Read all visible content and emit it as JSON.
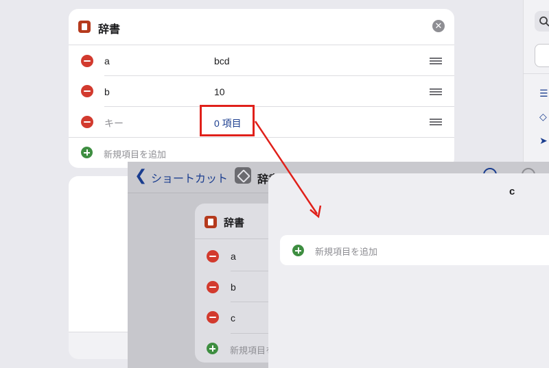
{
  "dictionary": {
    "title": "辞書",
    "rows": [
      {
        "key": "a",
        "value": "bcd"
      },
      {
        "key": "b",
        "value": "10"
      },
      {
        "key_placeholder": "キー",
        "value": "0 項目"
      }
    ],
    "add_label": "新規項目を追加"
  },
  "inset": {
    "back_label": "ショートカット",
    "nav_title": "辞書",
    "card_title": "辞書",
    "rows": [
      "a",
      "b",
      "c"
    ],
    "add_label": "新規項目を追加"
  },
  "sheet": {
    "title": "c",
    "add_label": "新規項目を追加"
  },
  "colors": {
    "highlight": "#e0201a",
    "accent": "#1a3d8f",
    "remove": "#d23a2e",
    "add": "#3e8e41"
  }
}
